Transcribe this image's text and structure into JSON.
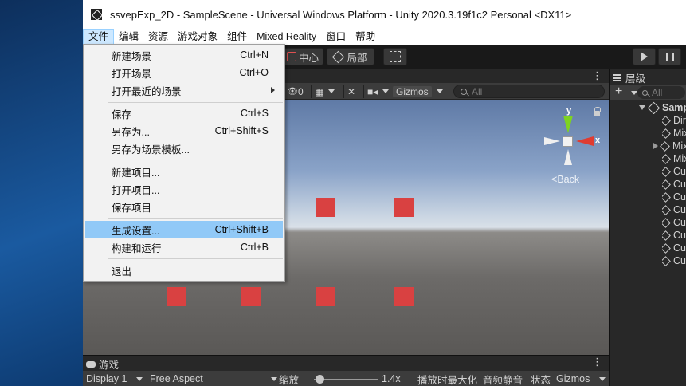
{
  "window": {
    "title": "ssvepExp_2D - SampleScene - Universal Windows Platform - Unity 2020.3.19f1c2 Personal <DX11>"
  },
  "menubar": [
    "文件",
    "编辑",
    "资源",
    "游戏对象",
    "组件",
    "Mixed Reality",
    "窗口",
    "帮助"
  ],
  "toolbar": {
    "pivot_label": "中心",
    "local_label": "局部",
    "play_icon": "play-icon",
    "pause_icon": "pause-icon"
  },
  "scene": {
    "hidden_count": "0",
    "gizmos": "Gizmos",
    "search_placeholder": "All",
    "axis_y": "y",
    "axis_x": "x",
    "back_label": "Back"
  },
  "game": {
    "tab": "游戏",
    "display": "Display 1",
    "aspect": "Free Aspect",
    "scale_label": "缩放",
    "scale_value": "1.4x",
    "maximize_on_play": "播放时最大化",
    "mute_audio": "音频静音",
    "stats": "状态",
    "gizmos": "Gizmos"
  },
  "hierarchy": {
    "tab": "层级",
    "search_placeholder": "All",
    "items": [
      {
        "label": "Samp",
        "kind": "scene"
      },
      {
        "label": "Dir",
        "kind": "object"
      },
      {
        "label": "Mix",
        "kind": "object"
      },
      {
        "label": "Mix",
        "kind": "collapsed"
      },
      {
        "label": "Mix",
        "kind": "object"
      },
      {
        "label": "Cul",
        "kind": "object"
      },
      {
        "label": "Cul",
        "kind": "object"
      },
      {
        "label": "Cul",
        "kind": "object"
      },
      {
        "label": "Cul",
        "kind": "object"
      },
      {
        "label": "Cul",
        "kind": "object"
      },
      {
        "label": "Cul",
        "kind": "object"
      },
      {
        "label": "Cul",
        "kind": "object"
      },
      {
        "label": "Cul",
        "kind": "object"
      }
    ]
  },
  "file_menu": {
    "items": [
      {
        "label": "新建场景",
        "shortcut": "Ctrl+N"
      },
      {
        "label": "打开场景",
        "shortcut": "Ctrl+O"
      },
      {
        "label": "打开最近的场景",
        "shortcut": "",
        "submenu": true
      },
      {
        "label": "保存",
        "shortcut": "Ctrl+S"
      },
      {
        "label": "另存为...",
        "shortcut": "Ctrl+Shift+S"
      },
      {
        "label": "另存为场景模板...",
        "shortcut": ""
      },
      {
        "label": "新建项目...",
        "shortcut": ""
      },
      {
        "label": "打开项目...",
        "shortcut": ""
      },
      {
        "label": "保存项目",
        "shortcut": ""
      },
      {
        "label": "生成设置...",
        "shortcut": "Ctrl+Shift+B",
        "highlighted": true
      },
      {
        "label": "构建和运行",
        "shortcut": "Ctrl+B"
      },
      {
        "label": "退出",
        "shortcut": ""
      }
    ]
  },
  "colors": {
    "cube": "#d94141",
    "highlight": "#91c9f7",
    "axis_x": "#e03c31",
    "axis_y": "#7ed321"
  }
}
